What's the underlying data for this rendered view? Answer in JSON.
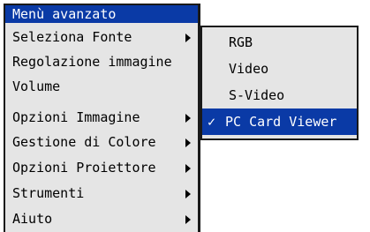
{
  "menu": {
    "title": "Menù avanzato",
    "items": [
      {
        "label": "Seleziona Fonte",
        "submenu": true
      },
      {
        "label": "Regolazione immagine",
        "submenu": false
      },
      {
        "label": "Volume",
        "submenu": false
      },
      {
        "label": "Opzioni Immagine",
        "submenu": true
      },
      {
        "label": "Gestione di Colore",
        "submenu": true
      },
      {
        "label": "Opzioni Proiettore",
        "submenu": true
      },
      {
        "label": "Strumenti",
        "submenu": true
      },
      {
        "label": "Aiuto",
        "submenu": true
      }
    ]
  },
  "submenu": {
    "items": [
      {
        "label": "RGB"
      },
      {
        "label": "Video"
      },
      {
        "label": "S-Video"
      },
      {
        "label": "PC Card Viewer",
        "selected": true,
        "check": "✓"
      }
    ]
  },
  "colors": {
    "highlight": "#0a3aa6",
    "menu_bg": "#e5e5e5",
    "border": "#1a1a1a"
  }
}
